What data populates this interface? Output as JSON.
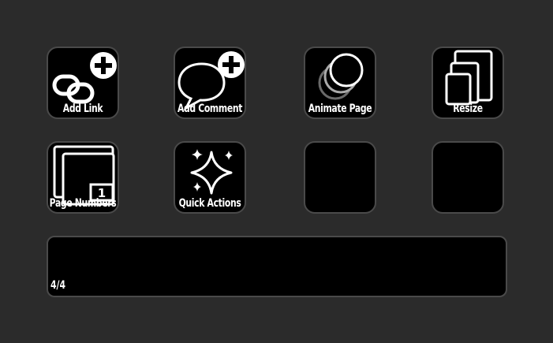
{
  "grid": {
    "keys": [
      {
        "label": "Add Link",
        "icon": "add-link-icon"
      },
      {
        "label": "Add Comment",
        "icon": "add-comment-icon"
      },
      {
        "label": "Animate Page",
        "icon": "animate-page-icon"
      },
      {
        "label": "Resize",
        "icon": "resize-icon"
      },
      {
        "label": "Page Numbers",
        "icon": "page-numbers-icon",
        "badge": "1"
      },
      {
        "label": "Quick Actions",
        "icon": "quick-actions-icon"
      },
      {
        "label": ""
      },
      {
        "label": ""
      }
    ]
  },
  "footer": {
    "page_indicator": "4/4"
  },
  "colors": {
    "background": "#2b2b2b",
    "key_fill": "#000000",
    "key_border": "#4a4a4a",
    "icon": "#ffffff"
  }
}
